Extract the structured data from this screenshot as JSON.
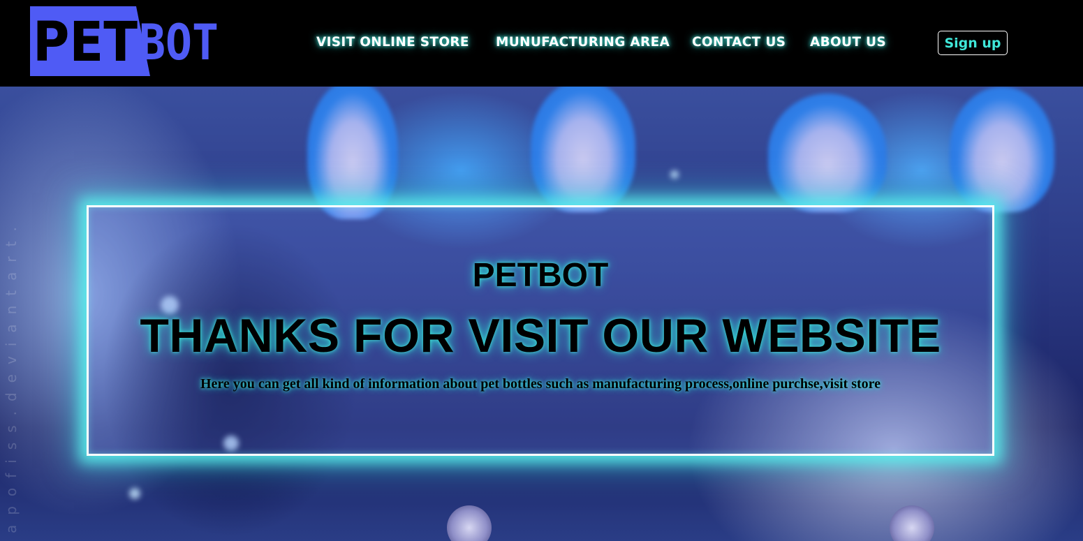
{
  "logo": {
    "part1": "PET",
    "part2": "BOT",
    "accent_color": "#4f5bf5"
  },
  "nav": {
    "items": [
      {
        "label": "VISIT ONLINE STORE"
      },
      {
        "label": "MUNUFACTURING AREA"
      },
      {
        "label": "CONTACT US"
      },
      {
        "label": "ABOUT US"
      }
    ],
    "signup_label": "Sign up"
  },
  "hero": {
    "watermark": "apofiss.deviantart.",
    "brand": "PETBOT",
    "title": "THANKS FOR VISIT OUR WEBSITE",
    "description": "Here you can get all kind of information about pet bottles such as manufacturing process,online purchse,visit store"
  },
  "colors": {
    "glow": "#3fe7d9",
    "header_bg": "#000000"
  }
}
